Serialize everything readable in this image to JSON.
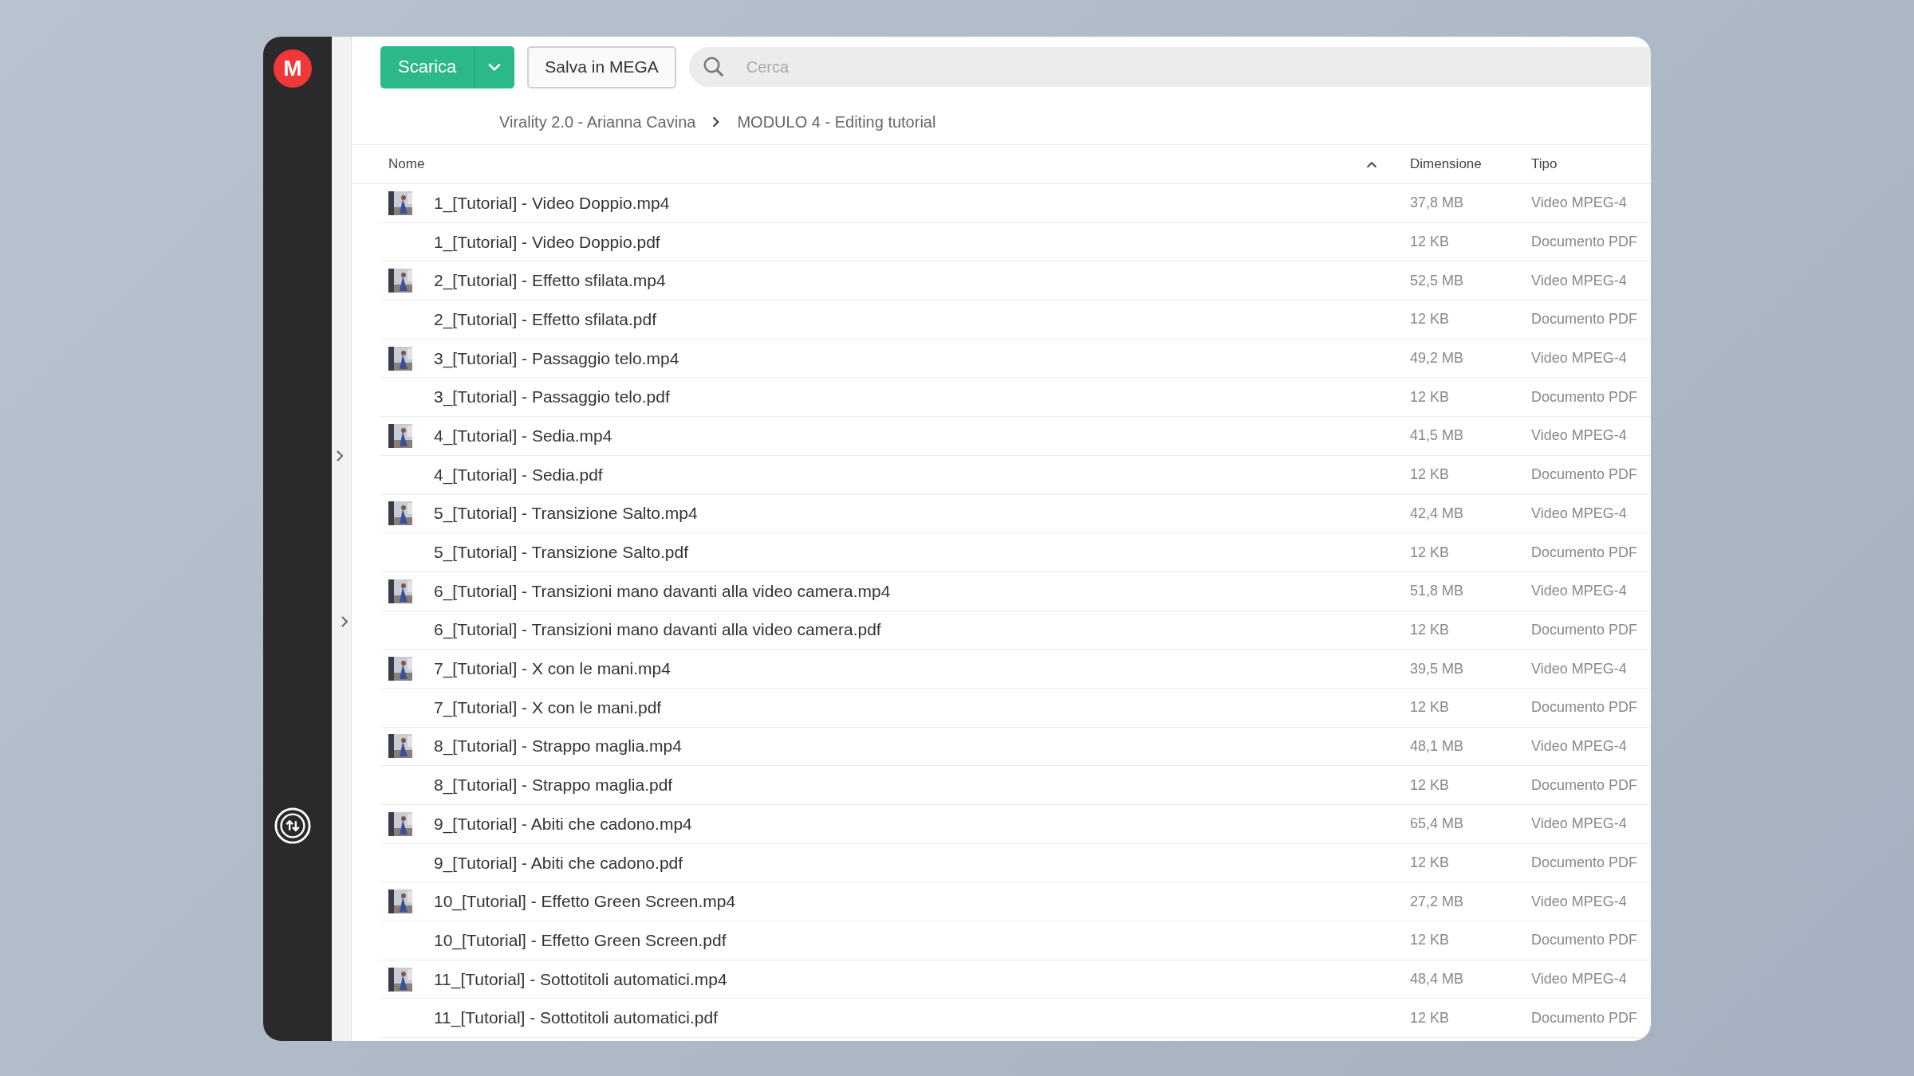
{
  "sidebar": {
    "logo": "M"
  },
  "toolbar": {
    "download_button": "Scarica",
    "save_button": "Salva in MEGA",
    "search": {
      "placeholder": "Cerca"
    }
  },
  "breadcrumb": [
    "Virality 2.0 - Arianna Cavina",
    "MODULO 4 - Editing tutorial"
  ],
  "table": {
    "columns": [
      "Nome",
      "Dimensione",
      "Tipo"
    ],
    "rows": [
      {
        "kind": "video",
        "name": "1_[Tutorial] - Video Doppio.mp4",
        "size": "37,8 MB",
        "type": "Video MPEG-4"
      },
      {
        "kind": "pdf",
        "name": "1_[Tutorial] - Video Doppio.pdf",
        "size": "12 KB",
        "type": "Documento PDF"
      },
      {
        "kind": "video",
        "name": "2_[Tutorial] - Effetto sfilata.mp4",
        "size": "52,5 MB",
        "type": "Video MPEG-4"
      },
      {
        "kind": "pdf",
        "name": "2_[Tutorial] - Effetto sfilata.pdf",
        "size": "12 KB",
        "type": "Documento PDF"
      },
      {
        "kind": "video",
        "name": "3_[Tutorial] - Passaggio telo.mp4",
        "size": "49,2 MB",
        "type": "Video MPEG-4"
      },
      {
        "kind": "pdf",
        "name": "3_[Tutorial] - Passaggio telo.pdf",
        "size": "12 KB",
        "type": "Documento PDF"
      },
      {
        "kind": "video",
        "name": "4_[Tutorial] - Sedia.mp4",
        "size": "41,5 MB",
        "type": "Video MPEG-4"
      },
      {
        "kind": "pdf",
        "name": "4_[Tutorial] - Sedia.pdf",
        "size": "12 KB",
        "type": "Documento PDF"
      },
      {
        "kind": "video",
        "name": "5_[Tutorial] - Transizione Salto.mp4",
        "size": "42,4 MB",
        "type": "Video MPEG-4"
      },
      {
        "kind": "pdf",
        "name": "5_[Tutorial] - Transizione Salto.pdf",
        "size": "12 KB",
        "type": "Documento PDF"
      },
      {
        "kind": "video",
        "name": "6_[Tutorial] - Transizioni mano davanti alla video camera.mp4",
        "size": "51,8 MB",
        "type": "Video MPEG-4"
      },
      {
        "kind": "pdf",
        "name": "6_[Tutorial] - Transizioni mano davanti alla video camera.pdf",
        "size": "12 KB",
        "type": "Documento PDF"
      },
      {
        "kind": "video",
        "name": "7_[Tutorial] - X con le mani.mp4",
        "size": "39,5 MB",
        "type": "Video MPEG-4"
      },
      {
        "kind": "pdf",
        "name": "7_[Tutorial] - X con le mani.pdf",
        "size": "12 KB",
        "type": "Documento PDF"
      },
      {
        "kind": "video",
        "name": "8_[Tutorial] - Strappo maglia.mp4",
        "size": "48,1 MB",
        "type": "Video MPEG-4"
      },
      {
        "kind": "pdf",
        "name": "8_[Tutorial] - Strappo maglia.pdf",
        "size": "12 KB",
        "type": "Documento PDF"
      },
      {
        "kind": "video",
        "name": "9_[Tutorial] - Abiti che cadono.mp4",
        "size": "65,4 MB",
        "type": "Video MPEG-4"
      },
      {
        "kind": "pdf",
        "name": "9_[Tutorial] - Abiti che cadono.pdf",
        "size": "12 KB",
        "type": "Documento PDF"
      },
      {
        "kind": "video",
        "name": "10_[Tutorial] - Effetto Green Screen.mp4",
        "size": "27,2 MB",
        "type": "Video MPEG-4"
      },
      {
        "kind": "pdf",
        "name": "10_[Tutorial] - Effetto Green Screen.pdf",
        "size": "12 KB",
        "type": "Documento PDF"
      },
      {
        "kind": "video",
        "name": "11_[Tutorial] - Sottotitoli automatici.mp4",
        "size": "48,4 MB",
        "type": "Video MPEG-4"
      },
      {
        "kind": "pdf",
        "name": "11_[Tutorial] - Sottotitoli automatici.pdf",
        "size": "12 KB",
        "type": "Documento PDF"
      }
    ]
  }
}
